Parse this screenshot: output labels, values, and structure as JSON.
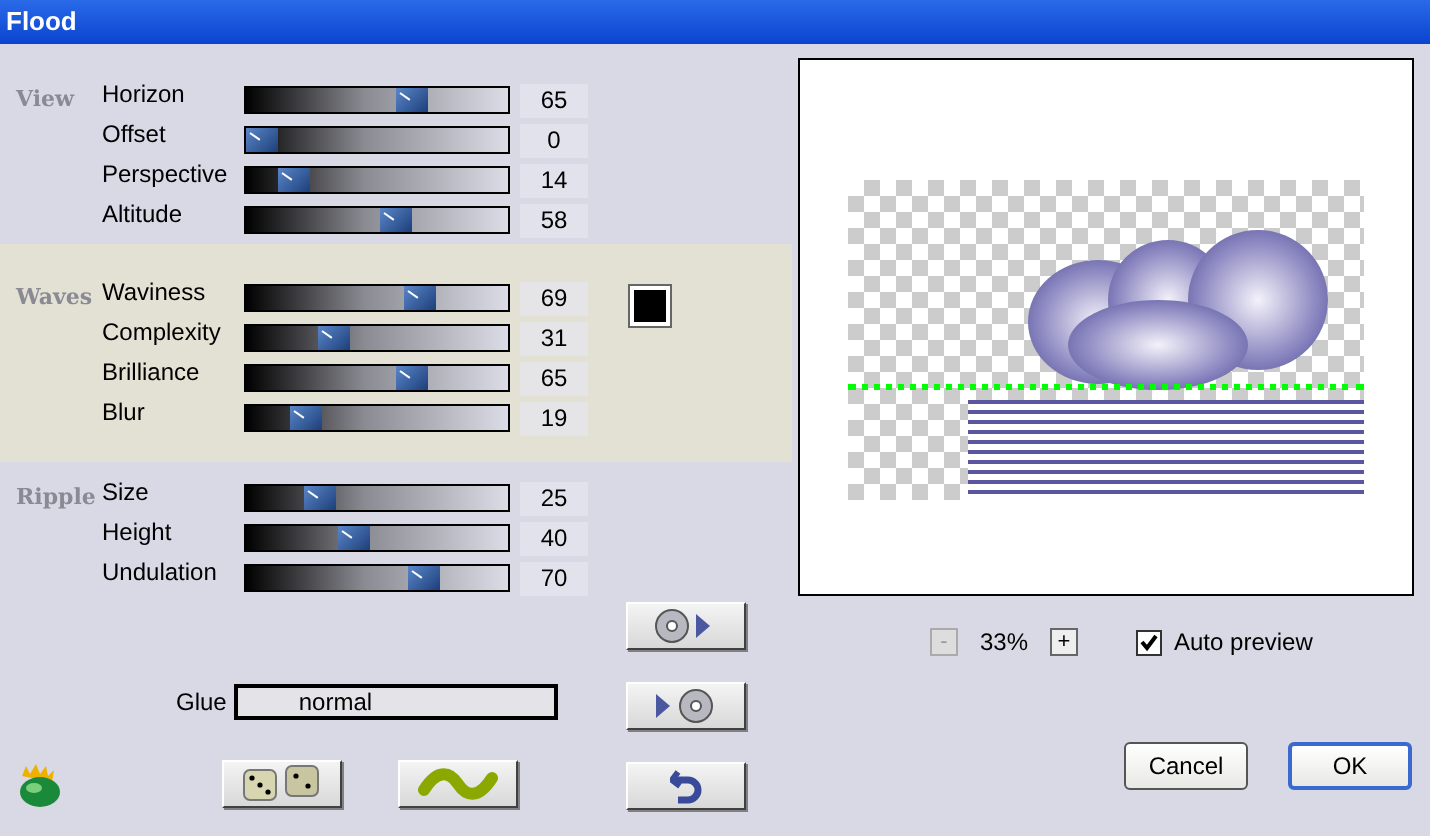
{
  "window": {
    "title": "Flood"
  },
  "sections": [
    {
      "title": "View",
      "sliders": [
        {
          "label": "Horizon",
          "level": 0.65,
          "value": "65"
        },
        {
          "label": "Offset",
          "level": 0,
          "value": "0"
        },
        {
          "label": "Perspective",
          "level": 0.14,
          "value": "14"
        },
        {
          "label": "Altitude",
          "level": 0.58,
          "value": "58"
        }
      ]
    },
    {
      "title": "Waves",
      "color": "#000000",
      "sliders": [
        {
          "label": "Waviness",
          "level": 0.69,
          "value": "69"
        },
        {
          "label": "Complexity",
          "level": 0.31,
          "value": "31"
        },
        {
          "label": "Brilliance",
          "level": 0.65,
          "value": "65"
        },
        {
          "label": "Blur",
          "level": 0.19,
          "value": "19"
        }
      ]
    },
    {
      "title": "Ripple",
      "sliders": [
        {
          "label": "Size",
          "level": 0.25,
          "value": "25"
        },
        {
          "label": "Height",
          "level": 0.4,
          "value": "40"
        },
        {
          "label": "Undulation",
          "level": 0.7,
          "value": "70"
        }
      ]
    }
  ],
  "glue": {
    "label": "Glue",
    "value": "normal"
  },
  "zoom": {
    "minus": "-",
    "minus_disabled": true,
    "value": "33%",
    "plus": "+"
  },
  "auto_preview": {
    "label": "Auto preview",
    "checked": true
  },
  "buttons": [
    {
      "label": "Cancel",
      "default": false
    },
    {
      "label": "OK",
      "default": true
    }
  ]
}
